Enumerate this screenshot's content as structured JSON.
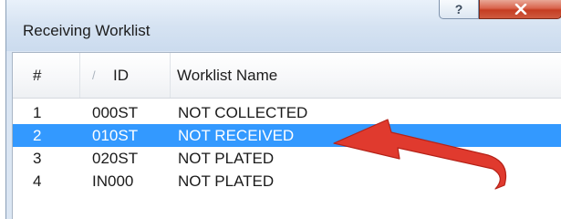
{
  "window": {
    "title": "Receiving Worklist",
    "help_label": "?",
    "close_label": "x"
  },
  "list": {
    "columns": [
      "#",
      "ID",
      "Worklist Name"
    ],
    "sort_indicator": "/",
    "rows": [
      {
        "num": "1",
        "id": "000ST",
        "name": "NOT COLLECTED",
        "selected": false
      },
      {
        "num": "2",
        "id": "010ST",
        "name": "NOT RECEIVED",
        "selected": true
      },
      {
        "num": "3",
        "id": "020ST",
        "name": "NOT PLATED",
        "selected": false
      },
      {
        "num": "4",
        "id": "IN000",
        "name": "NOT PLATED",
        "selected": false
      }
    ]
  },
  "annotation": {
    "icon": "red-arrow-icon",
    "color": "#e03a2e"
  }
}
